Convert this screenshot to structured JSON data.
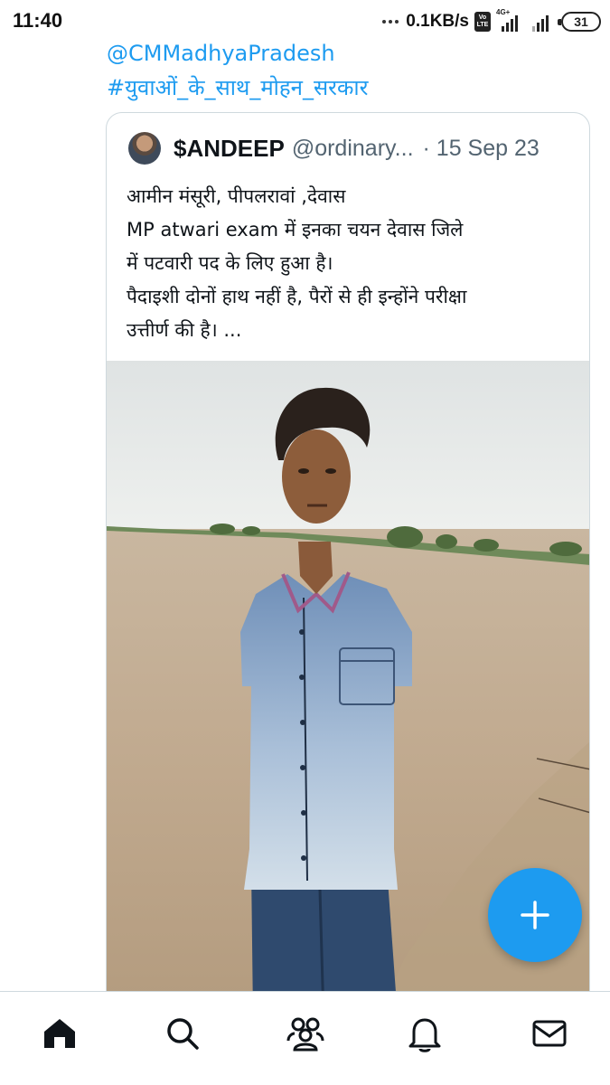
{
  "status_bar": {
    "time": "11:40",
    "net_speed": "0.1KB/s",
    "volte_label": "Vo LTE",
    "network_label": "4G+",
    "battery": "31"
  },
  "tweet": {
    "mention": "@CMMadhyaPradesh",
    "hashtag": "#युवाओं_के_साथ_मोहन_सरकार"
  },
  "quote": {
    "name": "$ANDEEP",
    "handle": "@ordinary...",
    "date": "· 15 Sep 23",
    "lines": [
      "आमीन मंसूरी, पीपलरावां ,देवास",
      "MP atwari exam में इनका चयन देवास जिले",
      "में पटवारी पद के लिए हुआ है।",
      "पैदाइशी दोनों हाथ नहीं है, पैरों से ही इन्होंने परीक्षा",
      "उत्तीर्ण की है। ..."
    ]
  },
  "icons": {
    "fab": "plus-icon",
    "nav": [
      "home-icon",
      "search-icon",
      "communities-icon",
      "bell-icon",
      "mail-icon"
    ]
  },
  "colors": {
    "accent": "#1d9bf0",
    "text_primary": "#0f1419",
    "text_secondary": "#536471",
    "border": "#cfd9de"
  }
}
